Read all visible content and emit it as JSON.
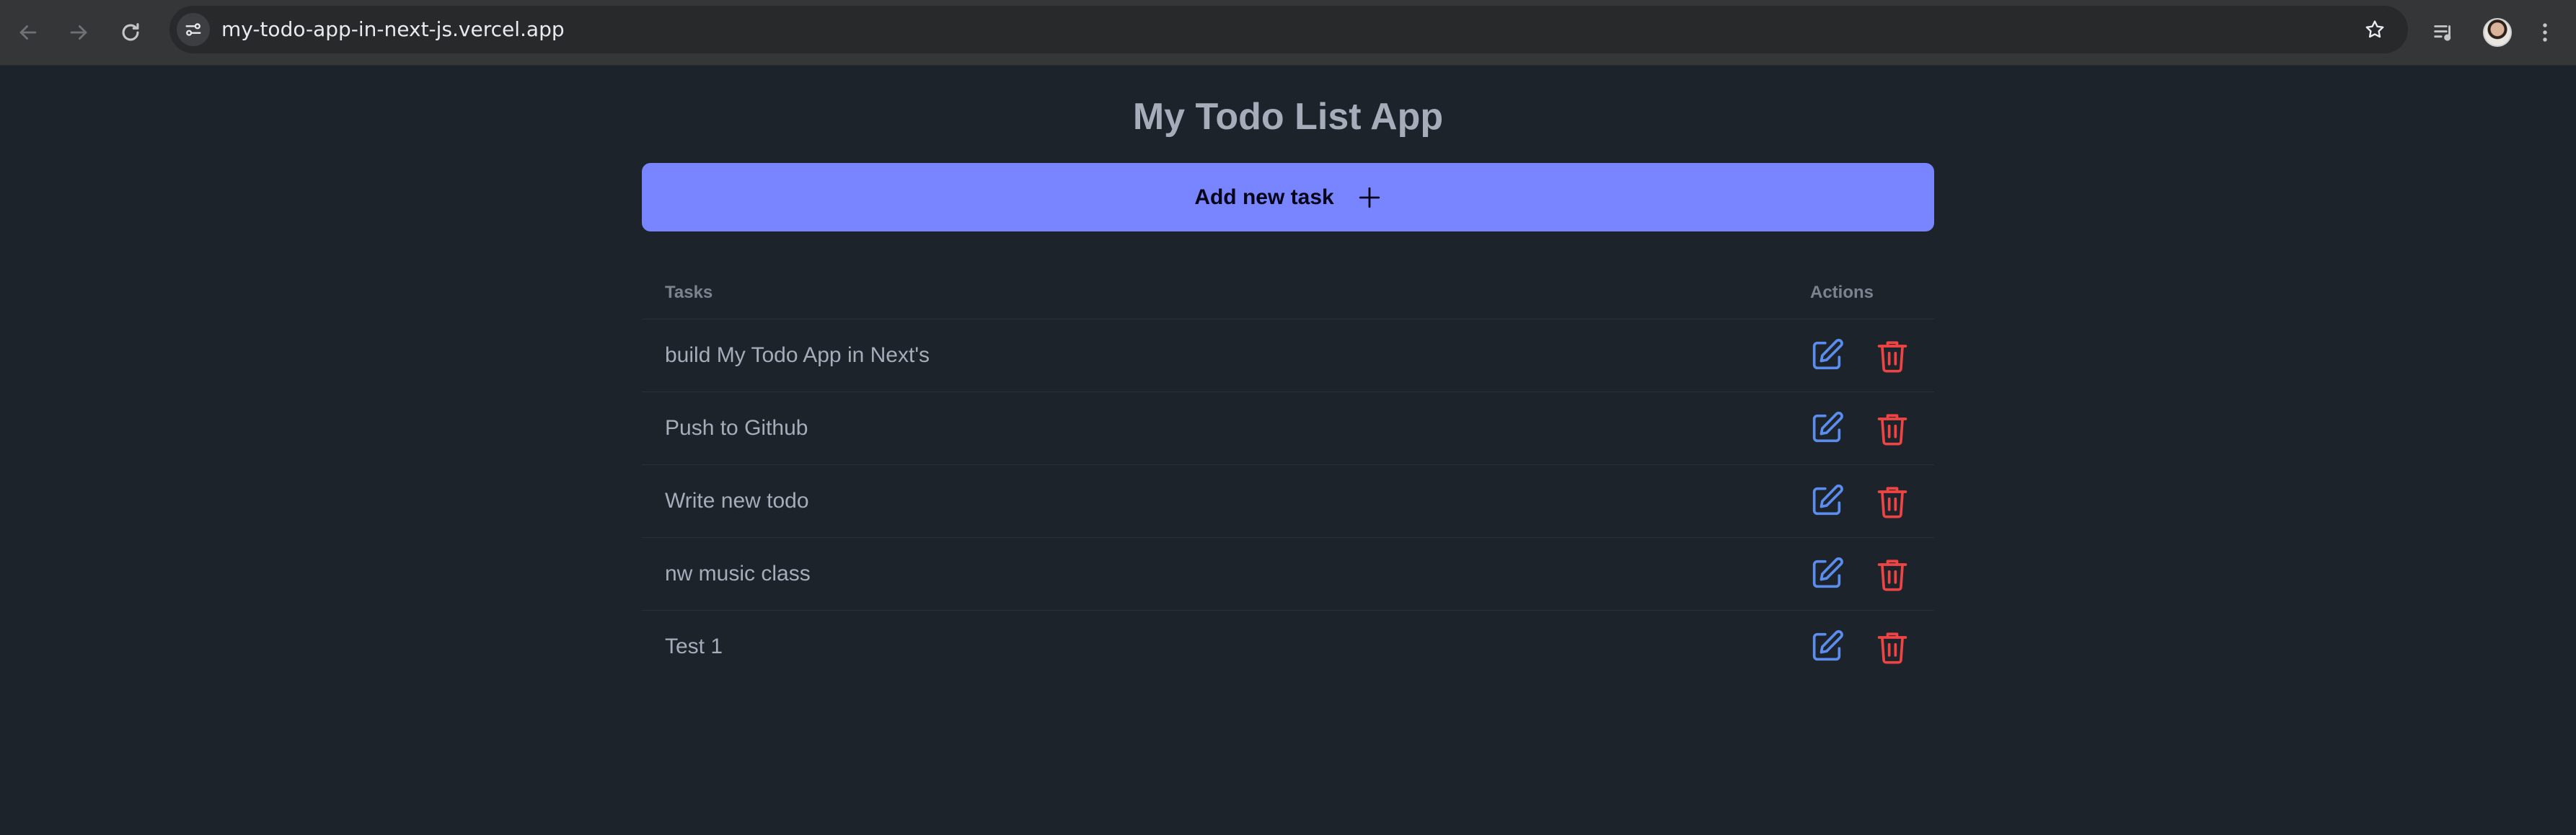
{
  "browser": {
    "url": "my-todo-app-in-next-js.vercel.app",
    "icons": {
      "back": "arrow-back-icon",
      "forward": "arrow-forward-icon",
      "reload": "reload-icon",
      "site_info": "tune-icon",
      "bookmark": "star-icon",
      "media": "media-control-icon",
      "profile": "avatar",
      "menu": "kebab-menu-icon"
    }
  },
  "app": {
    "title": "My Todo List App",
    "add_button_label": "Add new task",
    "add_button_icon": "plus-icon",
    "accent_color": "#7885ff",
    "edit_color": "#5b8def",
    "delete_color": "#ef4444"
  },
  "table": {
    "headers": {
      "tasks": "Tasks",
      "actions": "Actions"
    },
    "rows": [
      {
        "task": "build My Todo App in Next's"
      },
      {
        "task": "Push to Github"
      },
      {
        "task": "Write new todo"
      },
      {
        "task": "nw music class"
      },
      {
        "task": "Test 1"
      }
    ]
  }
}
